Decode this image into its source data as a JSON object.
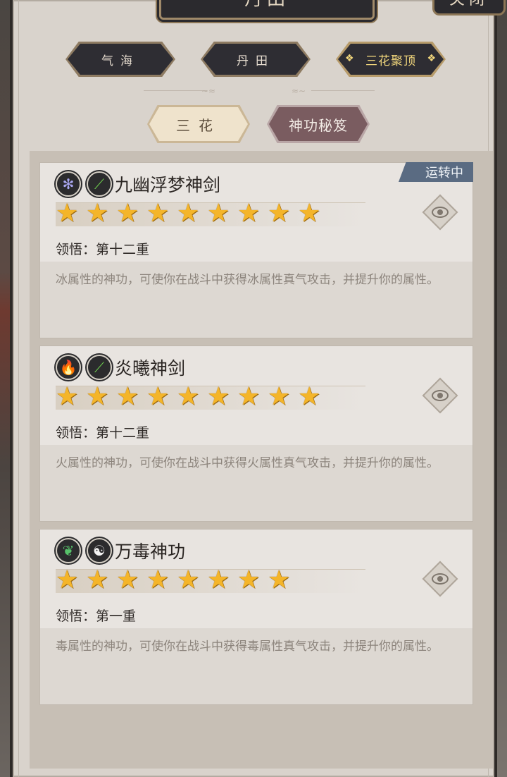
{
  "header": {
    "title": "丹田",
    "close_label": "关闭"
  },
  "tabs": [
    {
      "label": "气海",
      "active": false
    },
    {
      "label": "丹田",
      "active": false
    },
    {
      "label": "三花聚顶",
      "active": true
    }
  ],
  "subtabs": [
    {
      "label": "三花",
      "active": false
    },
    {
      "label": "神功秘笈",
      "active": true
    }
  ],
  "skills": [
    {
      "name": "九幽浮梦神剑",
      "element_icons": [
        "ice-flower-icon",
        "sword-wind-icon"
      ],
      "stars": 9,
      "level_text": "领悟：第十二重",
      "description": "冰属性的神功，可使你在战斗中获得冰属性真气攻击，并提升你的属性。",
      "status": "运转中"
    },
    {
      "name": "炎曦神剑",
      "element_icons": [
        "fire-icon",
        "sword-wind-icon"
      ],
      "stars": 9,
      "level_text": "领悟：第十二重",
      "description": "火属性的神功，可使你在战斗中获得火属性真气攻击，并提升你的属性。",
      "status": ""
    },
    {
      "name": "万毒神功",
      "element_icons": [
        "poison-leaf-icon",
        "yin-yang-icon"
      ],
      "stars": 8,
      "level_text": "领悟：第一重",
      "description": "毒属性的神功，可使你在战斗中获得毒属性真气攻击，并提升你的属性。",
      "status": ""
    }
  ],
  "colors": {
    "star": "#f4b52a",
    "running_badge": "#5a6b82",
    "active_tab_text": "#f2d77c"
  }
}
